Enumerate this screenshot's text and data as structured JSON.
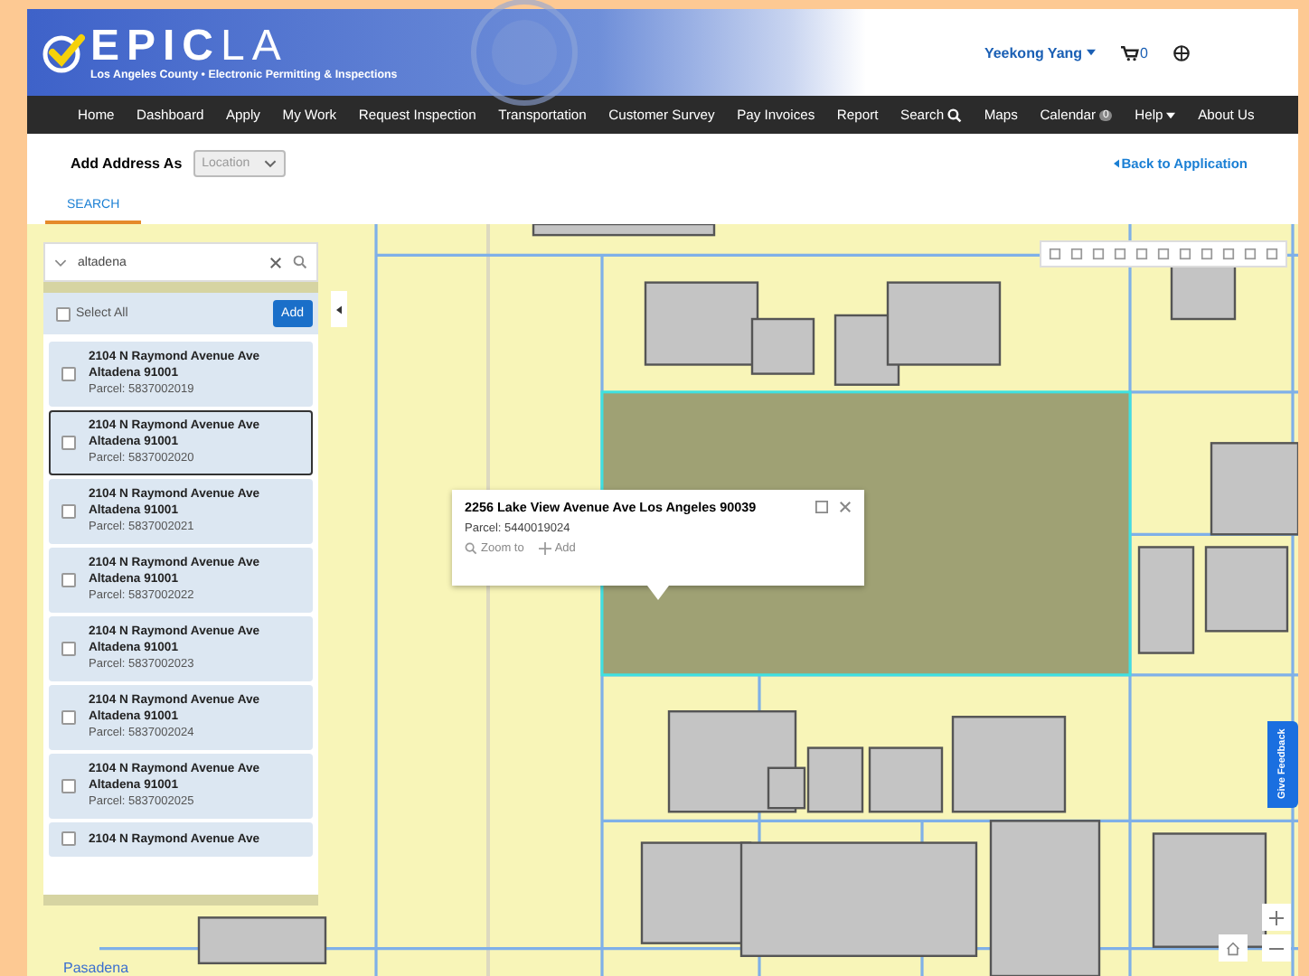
{
  "header": {
    "logo_bold": "EPIC",
    "logo_light": "LA",
    "subtitle": "Los Angeles County • Electronic Permitting & Inspections",
    "user": "Yeekong Yang",
    "cart_count": "0"
  },
  "nav": [
    {
      "label": "Home",
      "kind": "plain"
    },
    {
      "label": "Dashboard",
      "kind": "plain"
    },
    {
      "label": "Apply",
      "kind": "plain"
    },
    {
      "label": "My Work",
      "kind": "plain"
    },
    {
      "label": "Request Inspection",
      "kind": "plain"
    },
    {
      "label": "Transportation",
      "kind": "plain"
    },
    {
      "label": "Customer Survey",
      "kind": "plain"
    },
    {
      "label": "Pay Invoices",
      "kind": "plain"
    },
    {
      "label": "Report",
      "kind": "plain"
    },
    {
      "label": "Search",
      "kind": "search"
    },
    {
      "label": "Maps",
      "kind": "plain"
    },
    {
      "label": "Calendar",
      "kind": "badge",
      "badge": "0"
    },
    {
      "label": "Help",
      "kind": "dropdown"
    },
    {
      "label": "About Us",
      "kind": "plain"
    }
  ],
  "address_row": {
    "label": "Add Address As",
    "select_value": "Location",
    "select_disabled": true,
    "back_link": "Back to Application"
  },
  "tabs": [
    {
      "label": "SEARCH",
      "selected": true
    }
  ],
  "search_panel": {
    "query": "altadena",
    "select_all_label": "Select All",
    "select_all_checked": false,
    "add_button": "Add",
    "results": [
      {
        "address": "2104 N Raymond Avenue Ave",
        "city": "Altadena 91001",
        "parcel": "Parcel: 5837002019",
        "checked": false,
        "selected": false
      },
      {
        "address": "2104 N Raymond Avenue Ave",
        "city": "Altadena 91001",
        "parcel": "Parcel: 5837002020",
        "checked": false,
        "selected": true
      },
      {
        "address": "2104 N Raymond Avenue Ave",
        "city": "Altadena 91001",
        "parcel": "Parcel: 5837002021",
        "checked": false,
        "selected": false
      },
      {
        "address": "2104 N Raymond Avenue Ave",
        "city": "Altadena 91001",
        "parcel": "Parcel: 5837002022",
        "checked": false,
        "selected": false
      },
      {
        "address": "2104 N Raymond Avenue Ave",
        "city": "Altadena 91001",
        "parcel": "Parcel: 5837002023",
        "checked": false,
        "selected": false
      },
      {
        "address": "2104 N Raymond Avenue Ave",
        "city": "Altadena 91001",
        "parcel": "Parcel: 5837002024",
        "checked": false,
        "selected": false
      },
      {
        "address": "2104 N Raymond Avenue Ave",
        "city": "Altadena 91001",
        "parcel": "Parcel: 5837002025",
        "checked": false,
        "selected": false
      },
      {
        "address": "2104 N Raymond Avenue Ave",
        "checked": false,
        "selected": false
      }
    ]
  },
  "popup": {
    "title": "2256 Lake View Avenue Ave Los Angeles 90039",
    "parcel": "Parcel: 5440019024",
    "zoom_to": "Zoom to",
    "add": "Add"
  },
  "map": {
    "place_label": "Pasadena",
    "feedback_button": "Give Feedback"
  }
}
